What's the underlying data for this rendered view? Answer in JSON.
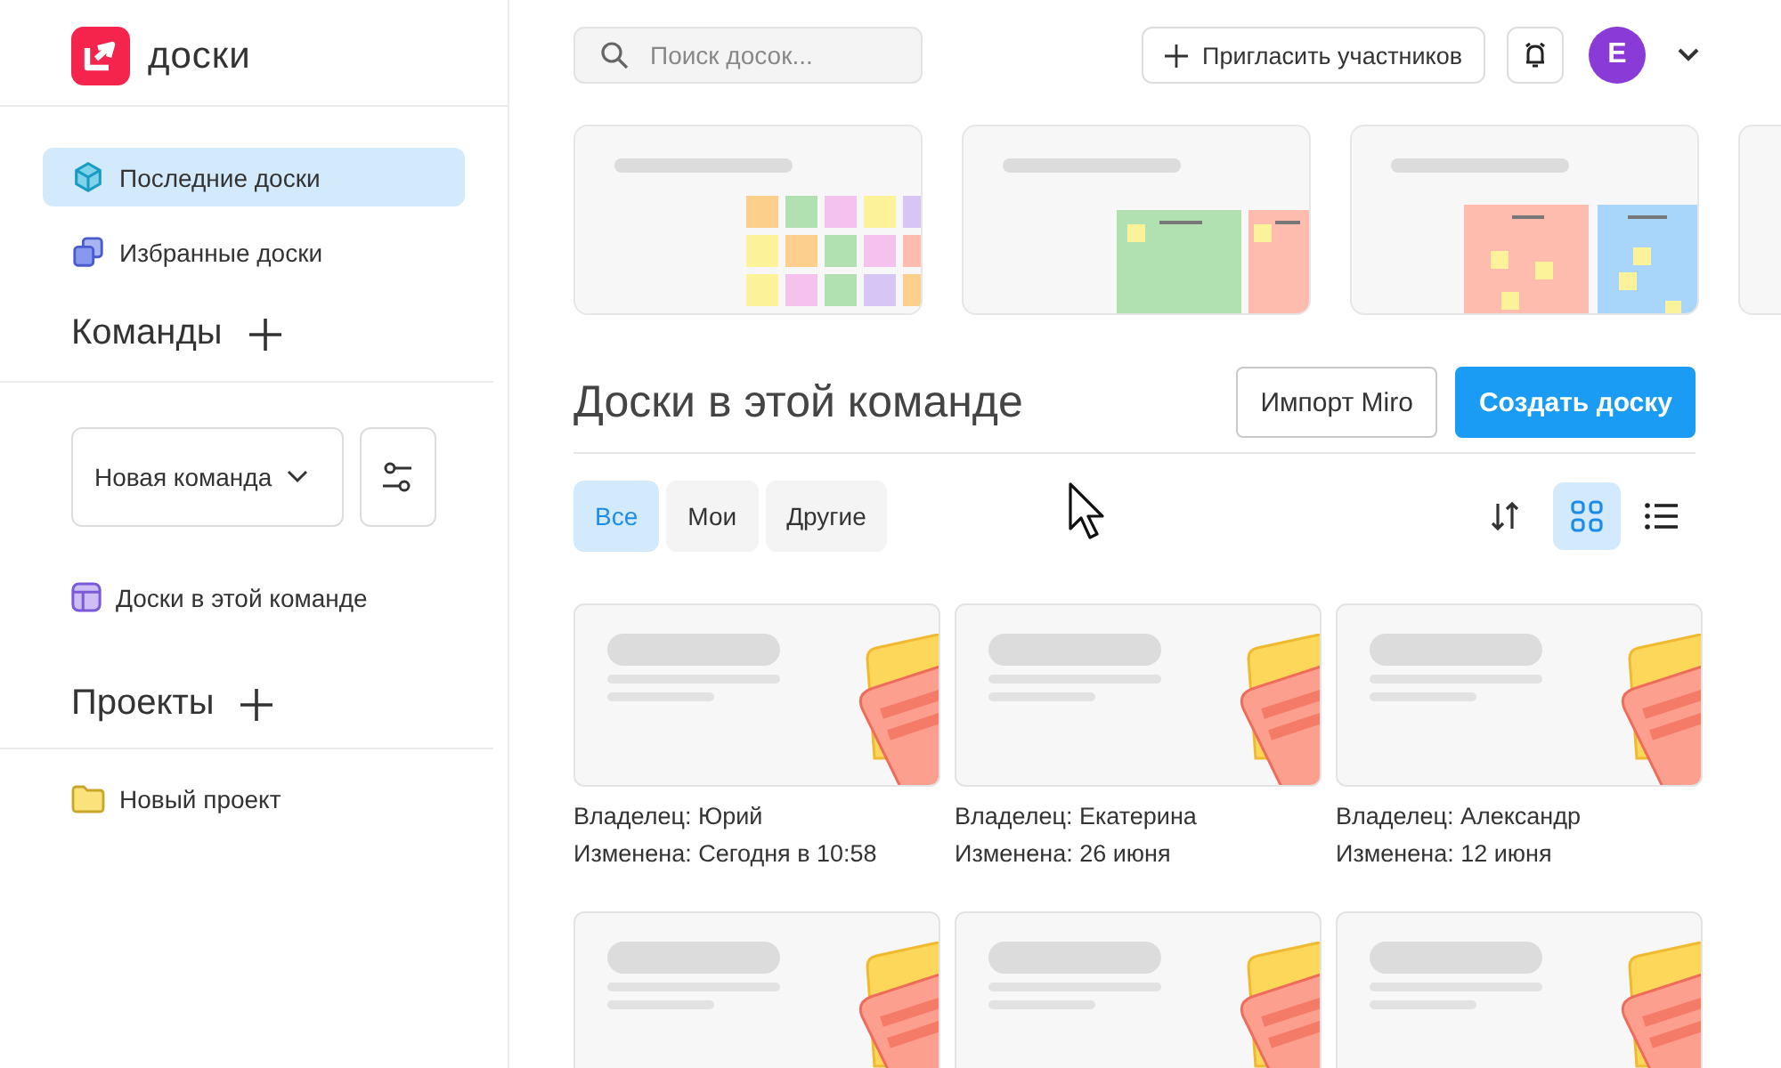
{
  "logo": {
    "text": "доски"
  },
  "nav": [
    {
      "label": "Последние доски",
      "selected": true
    },
    {
      "label": "Избранные доски",
      "selected": false
    }
  ],
  "teams_heading": "Команды",
  "team_select": {
    "value": "Новая команда"
  },
  "team_items": [
    {
      "label": "Доски в этой команде"
    }
  ],
  "projects_heading": "Проекты",
  "projects": [
    {
      "label": "Новый проект"
    }
  ],
  "search": {
    "placeholder": "Поиск досок..."
  },
  "invite_button": "Пригласить участников",
  "avatar": {
    "letter": "E",
    "color": "#8a3ad6"
  },
  "templates": [
    {
      "kind": "grid"
    },
    {
      "kind": "columns"
    },
    {
      "kind": "kanban"
    },
    {
      "kind": "blank"
    }
  ],
  "section_title": "Доски в этой команде",
  "import_button": "Импорт Miro",
  "create_button": "Создать доску",
  "filters": [
    {
      "label": "Все",
      "selected": true
    },
    {
      "label": "Мои",
      "selected": false
    },
    {
      "label": "Другие",
      "selected": false
    }
  ],
  "view_modes": [
    {
      "kind": "grid",
      "selected": true
    },
    {
      "kind": "list",
      "selected": false
    }
  ],
  "boards": [
    {
      "kind": "board",
      "owner": "Владелец: Юрий",
      "modified": "Изменена: Сегодня в 10:58"
    },
    {
      "kind": "board",
      "owner": "Владелец: Екатерина",
      "modified": "Изменена: 26 июня"
    },
    {
      "kind": "board",
      "owner": "Владелец: Александр",
      "modified": "Изменена: 12 июня"
    },
    {
      "kind": "board"
    },
    {
      "kind": "board"
    },
    {
      "kind": "board"
    }
  ]
}
